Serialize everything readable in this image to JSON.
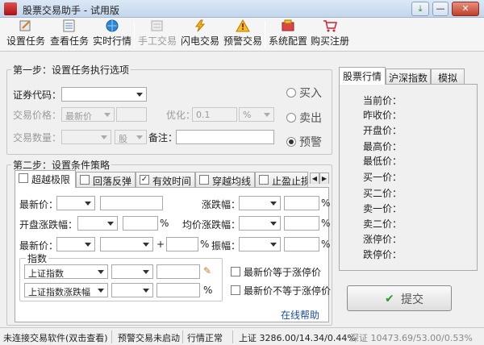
{
  "window": {
    "title": "股票交易助手 - 试用版",
    "min": "—",
    "max": "□",
    "close": "✕"
  },
  "toolbar": {
    "items": [
      {
        "label": "设置任务",
        "icon": "settings-task-icon"
      },
      {
        "label": "查看任务",
        "icon": "view-task-icon"
      },
      {
        "label": "实时行情",
        "icon": "quote-globe-icon"
      },
      {
        "label": "手工交易",
        "icon": "manual-trade-icon"
      },
      {
        "label": "闪电交易",
        "icon": "lightning-icon"
      },
      {
        "label": "预警交易",
        "icon": "alert-icon"
      },
      {
        "label": "系统配置",
        "icon": "config-icon"
      },
      {
        "label": "购买注册",
        "icon": "cart-icon"
      }
    ]
  },
  "step1": {
    "title": "第一步：设置任务执行选项",
    "code_label": "证券代码：",
    "price_label": "交易价格：",
    "price_value": "最新价",
    "optimize_label": "优化：",
    "optimize_value": "0.1",
    "optimize_unit": "%",
    "qty_label": "交易数量：",
    "qty_unit": "股",
    "note_label": "备注：",
    "radios": [
      {
        "label": "买入",
        "checked": false
      },
      {
        "label": "卖出",
        "checked": false
      },
      {
        "label": "预警",
        "checked": true
      }
    ]
  },
  "step2": {
    "title": "第二步：设置条件策略",
    "tabs": [
      {
        "label": "超越极限",
        "checked": false
      },
      {
        "label": "回落反弹",
        "checked": false
      },
      {
        "label": "有效时间",
        "checked": true
      },
      {
        "label": "穿越均线",
        "checked": false
      },
      {
        "label": "止盈止损",
        "checked": false
      }
    ],
    "rows": {
      "latest_price": "最新价：",
      "fall_pct": "涨跌幅：",
      "open_pct": "开盘涨跌幅：",
      "avg_pct": "均价涨跌幅：",
      "latest_price2": "最新价：",
      "plus": "+",
      "amplitude": "振幅：",
      "pct": "%"
    },
    "index": {
      "title": "指数",
      "sel1": "上证指数",
      "sel2": "上证指数涨跌幅",
      "chk1": "最新价等于涨停价",
      "chk2": "最新价不等于涨停价"
    },
    "help_link": "在线帮助"
  },
  "quote": {
    "tabs": [
      "股票行情",
      "沪深指数",
      "模拟"
    ],
    "labels": [
      "当前价：",
      "昨收价：",
      "开盘价：",
      "最高价：",
      "最低价：",
      "买一价：",
      "买二价：",
      "卖一价：",
      "卖二价：",
      "涨停价：",
      "跌停价："
    ]
  },
  "submit_label": "提交",
  "status": {
    "left": "未连接交易软件(双击查看)",
    "alert": "预警交易未启动",
    "market": "行情正常",
    "index": "上证 3286.00/14.34/0.44%",
    "index2": "深证 10473.69/53.00/0.53%"
  }
}
